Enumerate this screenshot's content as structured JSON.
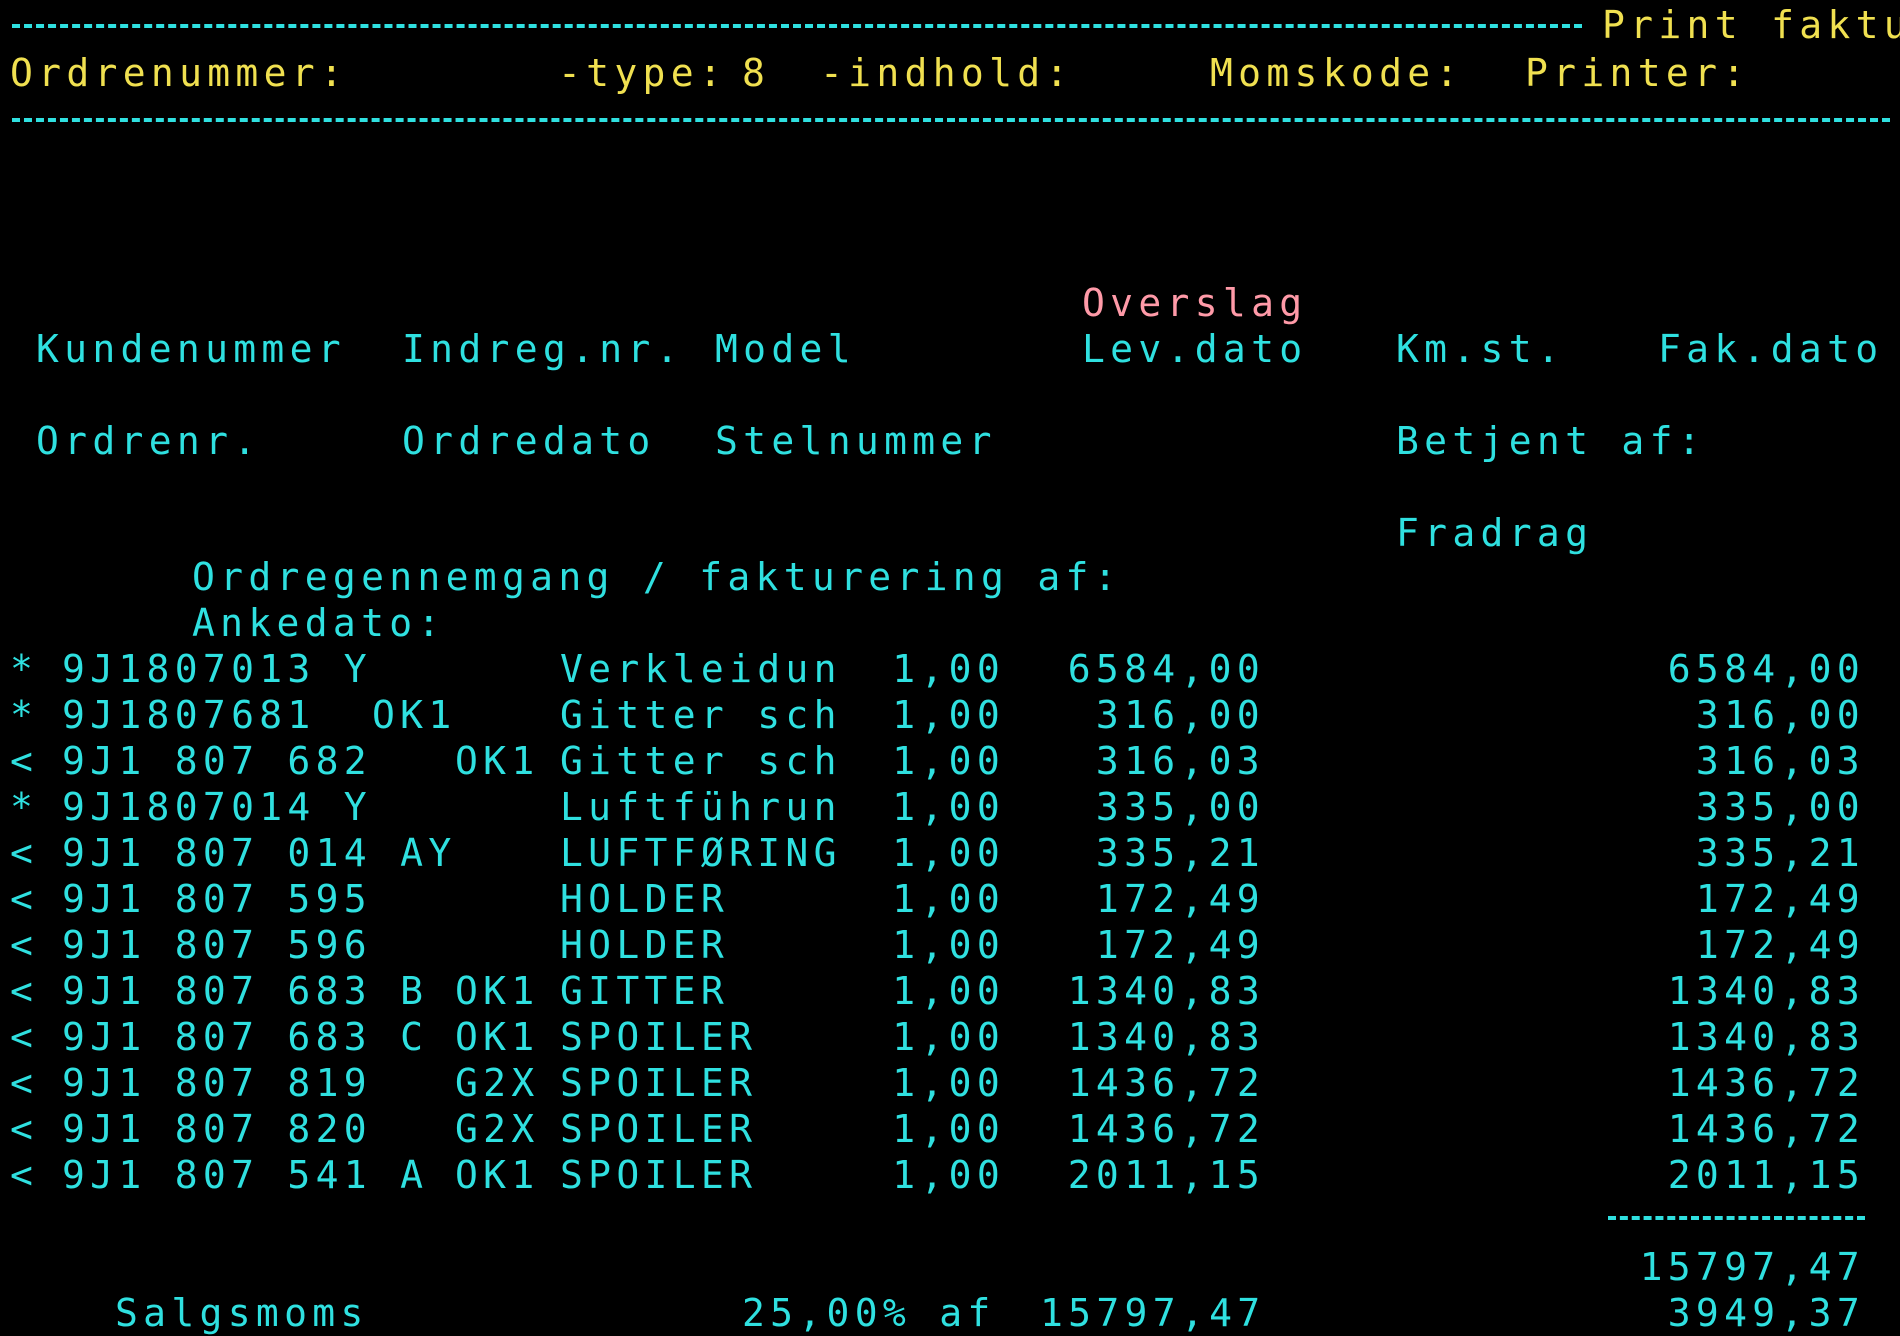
{
  "header": {
    "title": "Print faktu",
    "order_label": "Ordrenummer:",
    "type_label": "-type:",
    "type_value": "8",
    "content_label": "-indhold:",
    "vat_code_label": "Momskode:",
    "printer_label": "Printer:"
  },
  "info": {
    "estimate_label": "Overslag",
    "customer_no": "Kundenummer",
    "reg_no": "Indreg.nr.",
    "model": "Model",
    "delivery_date": "Lev.dato",
    "km": "Km.st.",
    "invoice_date": "Fak.dato",
    "order_no": "Ordrenr.",
    "order_date": "Ordredato",
    "vin": "Stelnummer",
    "served_by": "Betjent af:",
    "deduction": "Fradrag",
    "review": "Ordregennemgang / fakturering af:",
    "complaint_date": "Ankedato:"
  },
  "lines": [
    {
      "mark": "*",
      "part": "9J1807013 Y",
      "code": "",
      "desc": "Verkleidun",
      "qty": "1,00",
      "price": "6584,00",
      "total": "6584,00"
    },
    {
      "mark": "*",
      "part": "9J1807681  OK1",
      "code": "",
      "desc": "Gitter sch",
      "qty": "1,00",
      "price": "316,00",
      "total": "316,00"
    },
    {
      "mark": "<",
      "part": "9J1 807 682",
      "code": "OK1",
      "desc": "Gitter sch",
      "qty": "1,00",
      "price": "316,03",
      "total": "316,03"
    },
    {
      "mark": "*",
      "part": "9J1807014 Y",
      "code": "",
      "desc": "Luftführun",
      "qty": "1,00",
      "price": "335,00",
      "total": "335,00"
    },
    {
      "mark": "<",
      "part": "9J1 807 014 AY",
      "code": "",
      "desc": "LUFTFØRING",
      "qty": "1,00",
      "price": "335,21",
      "total": "335,21"
    },
    {
      "mark": "<",
      "part": "9J1 807 595",
      "code": "",
      "desc": "HOLDER",
      "qty": "1,00",
      "price": "172,49",
      "total": "172,49"
    },
    {
      "mark": "<",
      "part": "9J1 807 596",
      "code": "",
      "desc": "HOLDER",
      "qty": "1,00",
      "price": "172,49",
      "total": "172,49"
    },
    {
      "mark": "<",
      "part": "9J1 807 683 B",
      "code": "OK1",
      "desc": "GITTER",
      "qty": "1,00",
      "price": "1340,83",
      "total": "1340,83"
    },
    {
      "mark": "<",
      "part": "9J1 807 683 C",
      "code": "OK1",
      "desc": "SPOILER",
      "qty": "1,00",
      "price": "1340,83",
      "total": "1340,83"
    },
    {
      "mark": "<",
      "part": "9J1 807 819",
      "code": "G2X",
      "desc": "SPOILER",
      "qty": "1,00",
      "price": "1436,72",
      "total": "1436,72"
    },
    {
      "mark": "<",
      "part": "9J1 807 820",
      "code": "G2X",
      "desc": "SPOILER",
      "qty": "1,00",
      "price": "1436,72",
      "total": "1436,72"
    },
    {
      "mark": "<",
      "part": "9J1 807 541 A",
      "code": "OK1",
      "desc": "SPOILER",
      "qty": "1,00",
      "price": "2011,15",
      "total": "2011,15"
    }
  ],
  "totals": {
    "subtotal": "15797,47",
    "vat_label": "Salgsmoms",
    "vat_rate": "25,00% af",
    "vat_base": "15797,47",
    "vat_amount": "3949,37"
  },
  "colors": {
    "cyan": "#2fe0e0",
    "yellow": "#f0e050",
    "pink": "#ff9aa8",
    "background": "#000000"
  }
}
